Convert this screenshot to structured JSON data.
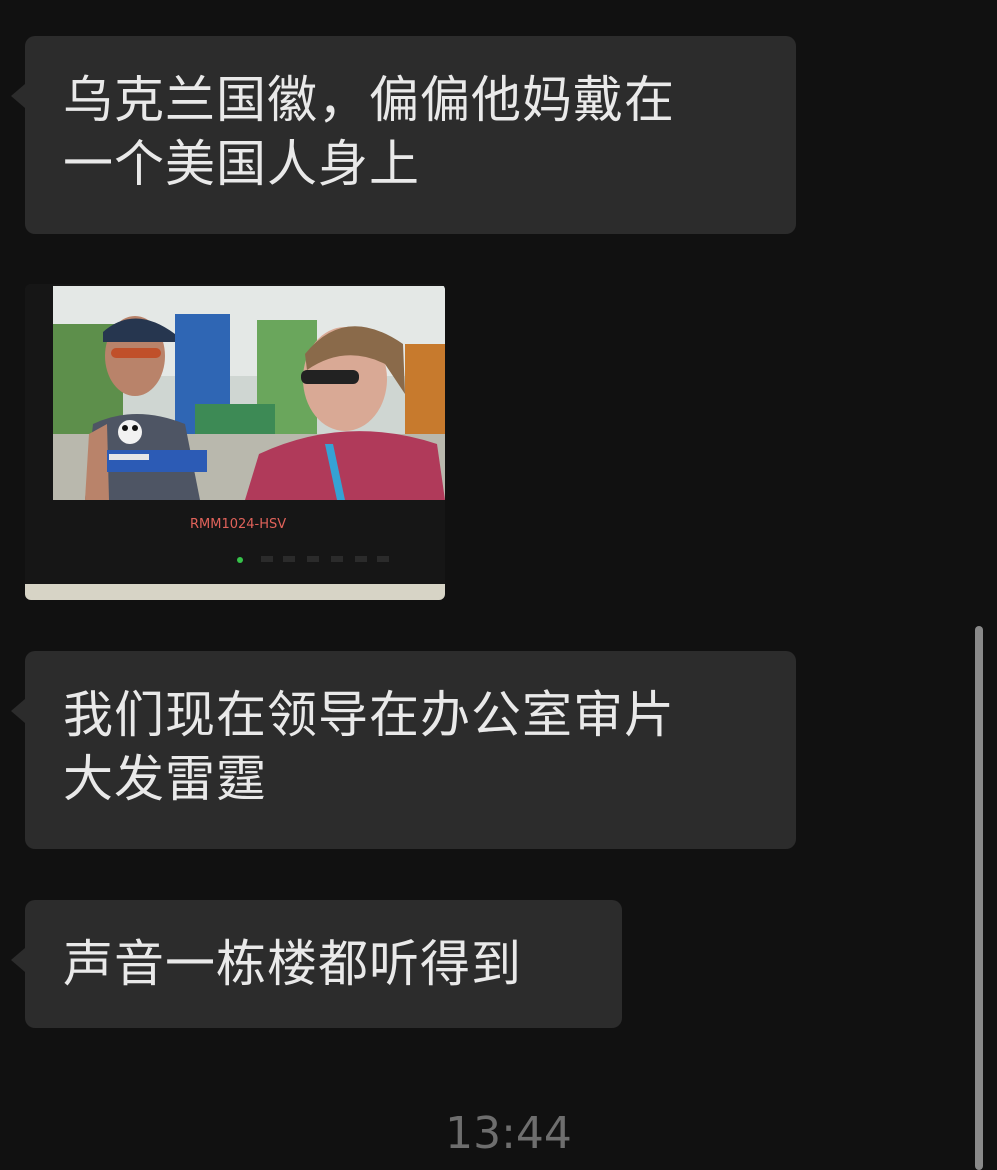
{
  "conversation": {
    "messages": [
      {
        "type": "text",
        "lines": [
          "乌克兰国徽，偏偏他妈戴在",
          "一个美国人身上"
        ]
      },
      {
        "type": "image",
        "overlay_text": "RMM1024-HSV"
      },
      {
        "type": "text",
        "lines": [
          "我们现在领导在办公室审片",
          "大发雷霆"
        ]
      },
      {
        "type": "text",
        "lines": [
          "声音一栋楼都听得到"
        ]
      }
    ],
    "timestamp": "13:44"
  },
  "colors": {
    "background": "#111111",
    "bubble": "#2c2c2c",
    "text": "#e9e9e9",
    "timestamp": "#6e6e6e"
  }
}
